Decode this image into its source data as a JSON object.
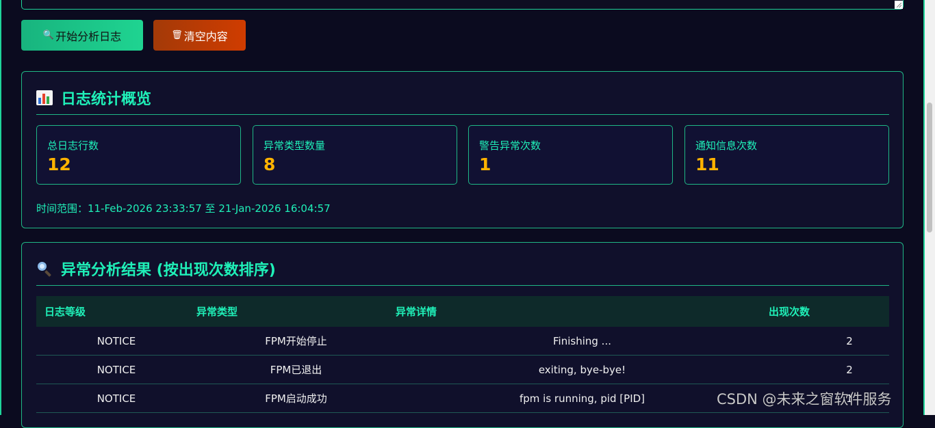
{
  "buttons": {
    "analyze_label": "开始分析日志",
    "clear_label": "清空内容"
  },
  "stats": {
    "title": "日志统计概览",
    "cards": [
      {
        "label": "总日志行数",
        "value": "12"
      },
      {
        "label": "异常类型数量",
        "value": "8"
      },
      {
        "label": "警告异常次数",
        "value": "1"
      },
      {
        "label": "通知信息次数",
        "value": "11"
      }
    ],
    "time_range": "时间范围：11-Feb-2026 23:33:57 至 21-Jan-2026 16:04:57"
  },
  "results": {
    "title": "异常分析结果 (按出现次数排序)",
    "columns": [
      "日志等级",
      "异常类型",
      "异常详情",
      "出现次数"
    ],
    "rows": [
      [
        "NOTICE",
        "FPM开始停止",
        "Finishing ...",
        "2"
      ],
      [
        "NOTICE",
        "FPM已退出",
        "exiting, bye-bye!",
        "2"
      ],
      [
        "NOTICE",
        "FPM启动成功",
        "fpm is running, pid [PID]",
        "1"
      ]
    ]
  },
  "watermark": "CSDN @未来之窗软件服务",
  "colors": {
    "accent": "#1ff0b8",
    "value": "#ffb300",
    "background": "#0b0b1f",
    "analyze_button": "#1fd491",
    "clear_button": "#d03c00"
  },
  "icons": {
    "analyze": "magnifier-icon",
    "clear": "trash-icon",
    "stats": "bar-chart-icon",
    "results": "magnifier-icon"
  }
}
